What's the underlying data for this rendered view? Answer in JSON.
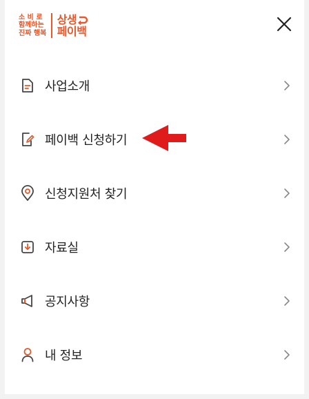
{
  "brand": {
    "tagline": [
      "소 비 로",
      "함께하는",
      "진짜 행복"
    ],
    "name_top": "상생",
    "name_bottom": "페이백",
    "color": "#e8572a"
  },
  "header": {
    "close_icon": "close-icon"
  },
  "menu": {
    "items": [
      {
        "label": "사업소개",
        "icon": "document-icon"
      },
      {
        "label": "페이백 신청하기",
        "icon": "edit-document-icon"
      },
      {
        "label": "신청지원처 찾기",
        "icon": "location-pin-icon"
      },
      {
        "label": "자료실",
        "icon": "download-box-icon"
      },
      {
        "label": "공지사항",
        "icon": "megaphone-icon"
      },
      {
        "label": "내 정보",
        "icon": "user-icon"
      }
    ]
  },
  "annotation": {
    "arrow_color": "#e01b1b"
  }
}
